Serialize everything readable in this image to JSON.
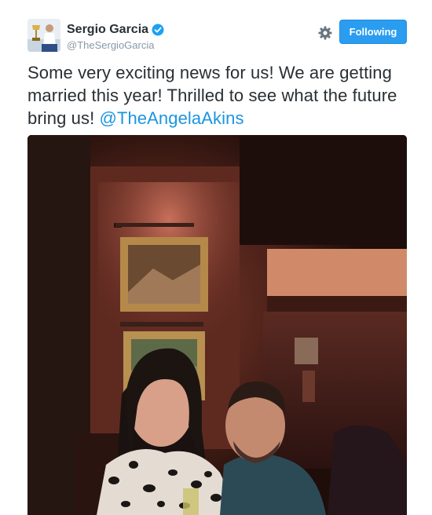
{
  "author": {
    "display_name": "Sergio Garcia",
    "handle": "@TheSergioGarcia",
    "verified": true,
    "avatar_icon": "golfer-avatar"
  },
  "actions": {
    "settings_icon": "gear-icon",
    "follow_label": "Following"
  },
  "tweet": {
    "text": "Some very exciting news for us! We are getting married this year! Thrilled to see what the future bring us! ",
    "mention": "@TheAngelaAkins"
  },
  "colors": {
    "follow_button": "#2b9df0",
    "mention": "#1b95e0",
    "verified_badge": "#1da1f2",
    "handle": "#8899a6"
  }
}
